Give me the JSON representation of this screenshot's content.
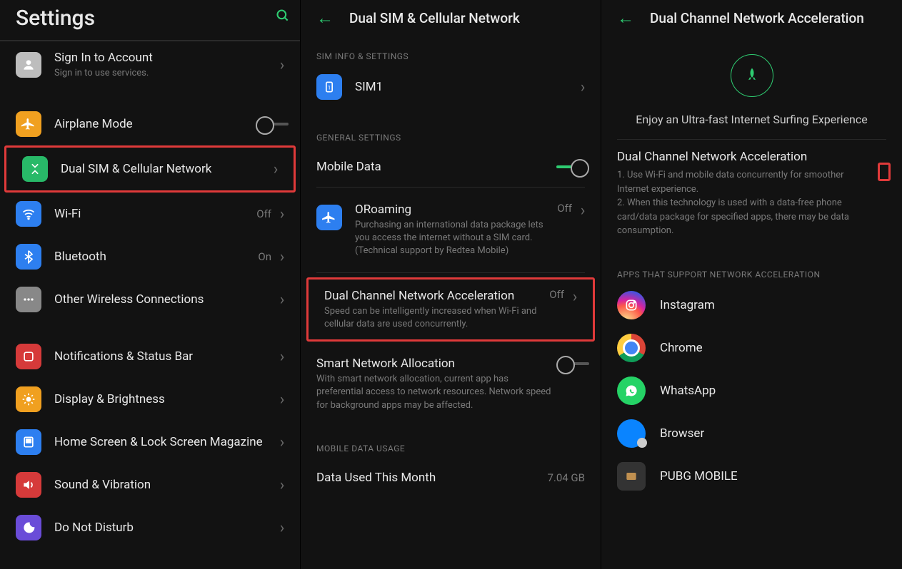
{
  "screen1": {
    "title": "Settings",
    "signin": {
      "title": "Sign In to Account",
      "sub": "Sign in to use services."
    },
    "items": [
      {
        "label": "Airplane Mode"
      },
      {
        "label": "Dual SIM & Cellular Network"
      },
      {
        "label": "Wi-Fi",
        "value": "Off"
      },
      {
        "label": "Bluetooth",
        "value": "On"
      },
      {
        "label": "Other Wireless Connections"
      },
      {
        "label": "Notifications & Status Bar"
      },
      {
        "label": "Display & Brightness"
      },
      {
        "label": "Home Screen & Lock Screen Magazine"
      },
      {
        "label": "Sound & Vibration"
      },
      {
        "label": "Do Not Disturb"
      }
    ]
  },
  "screen2": {
    "title": "Dual SIM & Cellular Network",
    "sections": {
      "sim_info": "SIM INFO & SETTINGS",
      "general": "GENERAL SETTINGS",
      "usage": "MOBILE DATA USAGE"
    },
    "sim1": "SIM1",
    "mobile_data": "Mobile Data",
    "oroaming": {
      "title": "ORoaming",
      "sub": "Purchasing an international data package lets you access the internet without a SIM card. (Technical support by Redtea Mobile)",
      "value": "Off"
    },
    "dcna": {
      "title": "Dual Channel Network Acceleration",
      "sub": "Speed can be intelligently increased when Wi-Fi and cellular data are used concurrently.",
      "value": "Off"
    },
    "smart": {
      "title": "Smart Network Allocation",
      "sub": "With smart network allocation, current app has preferential access to network resources. Network speed for background apps may be affected."
    },
    "data_used": {
      "label": "Data Used This Month",
      "value": "7.04 GB"
    }
  },
  "screen3": {
    "title": "Dual Channel Network Acceleration",
    "hero_caption": "Enjoy an Ultra-fast Internet Surfing Experience",
    "dcna": {
      "title": "Dual Channel Network Acceleration",
      "desc": "1. Use Wi-Fi and mobile data concurrently for smoother Internet experience.\n2. When this technology is used with a data-free phone card/data package for specified apps, there may be data consumption."
    },
    "apps_hdr": "APPS THAT SUPPORT NETWORK ACCELERATION",
    "apps": [
      {
        "label": "Instagram"
      },
      {
        "label": "Chrome"
      },
      {
        "label": "WhatsApp"
      },
      {
        "label": "Browser"
      },
      {
        "label": "PUBG MOBILE"
      }
    ]
  }
}
